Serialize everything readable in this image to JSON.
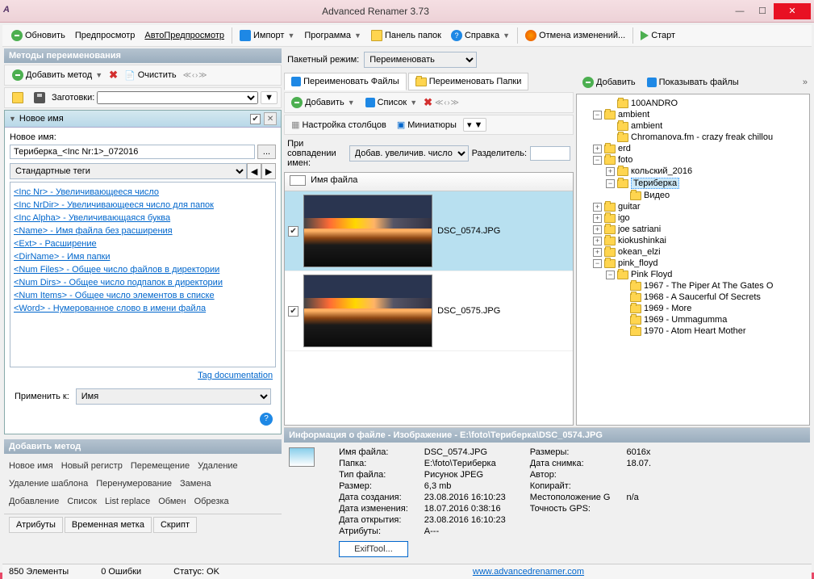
{
  "title": "Advanced Renamer 3.73",
  "toolbar": {
    "refresh": "Обновить",
    "preview": "Предпросмотр",
    "autopreview": "АвтоПредпросмотр",
    "import": "Импорт",
    "program": "Программа",
    "folder_panel": "Панель папок",
    "help": "Справка",
    "undo": "Отмена изменений...",
    "start": "Старт"
  },
  "methods": {
    "header": "Методы переименования",
    "add": "Добавить метод",
    "clear": "Очистить",
    "presets": "Заготовки:",
    "newname_title": "Новое имя",
    "newname_label": "Новое имя:",
    "newname_value": "Териберка_<Inc Nr:1>_072016",
    "std_tags": "Стандартные теги",
    "tags": [
      "<Inc Nr> - Увеличивающееся число",
      "<Inc NrDir> - Увеличивающееся число для папок",
      "<Inc Alpha> - Увеличивающаяся буква",
      "<Name> - Имя файла без расширения",
      "<Ext> - Расширение",
      "<DirName> - Имя папки",
      "<Num Files> - Общее число файлов в директории",
      "<Num Dirs> - Общее число подпапок в директории",
      "<Num Items> - Общее число элементов в списке",
      "<Word> - Нумерованное слово в имени файла"
    ],
    "tag_doc": "Tag documentation",
    "apply_to": "Применить к:",
    "apply_value": "Имя"
  },
  "addmethod": {
    "header": "Добавить метод",
    "row1": [
      "Новое имя",
      "Новый регистр",
      "Перемещение",
      "Удаление"
    ],
    "row2": [
      "Удаление шаблона",
      "Перенумерование",
      "Замена"
    ],
    "row3": [
      "Добавление",
      "Список",
      "List replace",
      "Обмен",
      "Обрезка"
    ],
    "tabs": [
      "Атрибуты",
      "Временная метка",
      "Скрипт"
    ]
  },
  "batch": {
    "mode_label": "Пакетный режим:",
    "mode_value": "Переименовать",
    "tab_files": "Переименовать Файлы",
    "tab_folders": "Переименовать Папки",
    "add": "Добавить",
    "list": "Список",
    "columns": "Настройка столбцов",
    "thumbs": "Миниатюры",
    "collision": "При совпадении имен:",
    "collision_value": "Добав. увеличив. число",
    "separator": "Разделитель:",
    "filename_col": "Имя файла",
    "files": [
      "DSC_0574.JPG",
      "DSC_0575.JPG"
    ]
  },
  "fileinfo": {
    "header": "Информация о файле - Изображение - E:\\foto\\Териберка\\DSC_0574.JPG",
    "labels": {
      "filename": "Имя файла:",
      "folder": "Папка:",
      "filetype": "Тип файла:",
      "size": "Размер:",
      "created": "Дата создания:",
      "modified": "Дата изменения:",
      "opened": "Дата открытия:",
      "attrs": "Атрибуты:",
      "dims": "Размеры:",
      "date": "Дата снимка:",
      "author": "Автор:",
      "copyright": "Копирайт:",
      "location": "Местоположение G",
      "gps": "Точность GPS:"
    },
    "values": {
      "filename": "DSC_0574.JPG",
      "folder": "E:\\foto\\Териберка",
      "filetype": "Рисунок JPEG",
      "size": "6,3 mb",
      "created": "23.08.2016 16:10:23",
      "modified": "18.07.2016 0:38:16",
      "opened": "23.08.2016 16:10:23",
      "attrs": "A---",
      "dims": "6016x",
      "date": "18.07.",
      "location": "n/a"
    },
    "exif": "ExifTool..."
  },
  "tree": {
    "add": "Добавить",
    "show_files": "Показывать файлы",
    "items": [
      {
        "indent": 2,
        "exp": "",
        "name": "100ANDRO"
      },
      {
        "indent": 1,
        "exp": "-",
        "name": "ambient"
      },
      {
        "indent": 2,
        "exp": "",
        "name": "ambient"
      },
      {
        "indent": 2,
        "exp": "",
        "name": "Chromanova.fm - crazy freak chillou"
      },
      {
        "indent": 1,
        "exp": "+",
        "name": "erd"
      },
      {
        "indent": 1,
        "exp": "-",
        "name": "foto"
      },
      {
        "indent": 2,
        "exp": "+",
        "name": "кольский_2016"
      },
      {
        "indent": 2,
        "exp": "-",
        "name": "Териберка",
        "selected": true
      },
      {
        "indent": 3,
        "exp": "",
        "name": "Видео"
      },
      {
        "indent": 1,
        "exp": "+",
        "name": "guitar"
      },
      {
        "indent": 1,
        "exp": "+",
        "name": "igo"
      },
      {
        "indent": 1,
        "exp": "+",
        "name": "joe satriani"
      },
      {
        "indent": 1,
        "exp": "+",
        "name": "kiokushinkai"
      },
      {
        "indent": 1,
        "exp": "+",
        "name": "okean_elzi"
      },
      {
        "indent": 1,
        "exp": "-",
        "name": "pink_floyd"
      },
      {
        "indent": 2,
        "exp": "-",
        "name": "Pink Floyd"
      },
      {
        "indent": 3,
        "exp": "",
        "name": "1967 - The Piper At The Gates O"
      },
      {
        "indent": 3,
        "exp": "",
        "name": "1968 - A Saucerful Of Secrets"
      },
      {
        "indent": 3,
        "exp": "",
        "name": "1969 - More"
      },
      {
        "indent": 3,
        "exp": "",
        "name": "1969 - Ummagumma"
      },
      {
        "indent": 3,
        "exp": "",
        "name": "1970 - Atom Heart Mother"
      }
    ]
  },
  "status": {
    "elements": "850 Элементы",
    "errors": "0 Ошибки",
    "status": "Статус: OK",
    "url": "www.advancedrenamer.com"
  }
}
